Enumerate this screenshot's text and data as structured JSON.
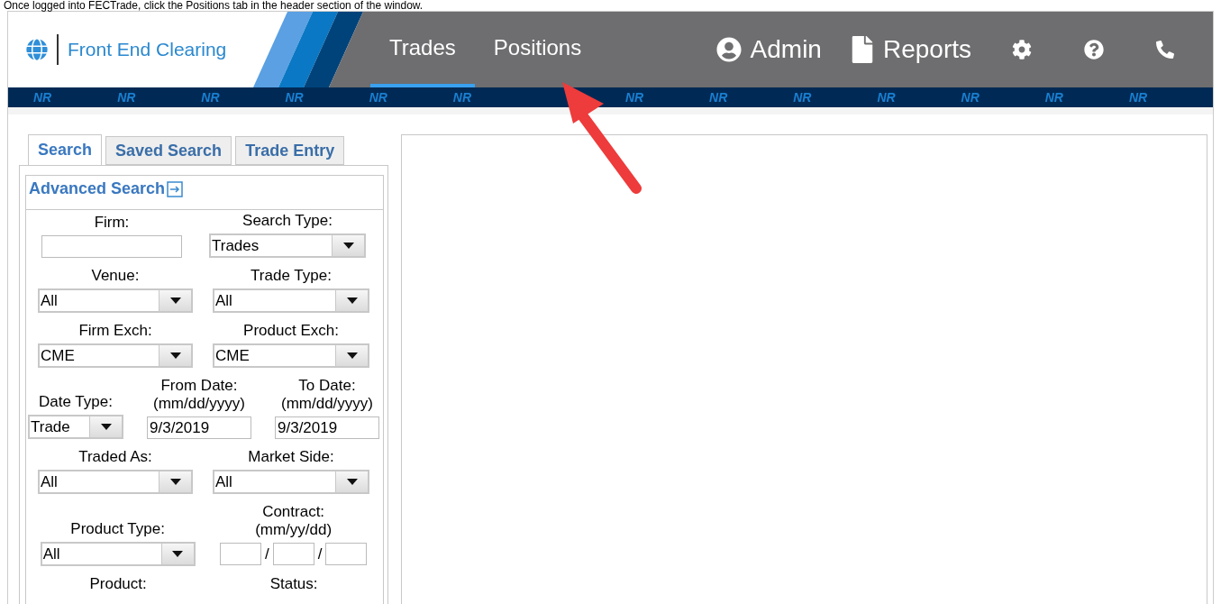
{
  "caption": "Once logged into FECTrade, click the Positions tab in the header section of the window.",
  "header": {
    "logo_text": "Front End Clearing",
    "nav": [
      {
        "label": "Trades",
        "selected": true
      },
      {
        "label": "Positions",
        "selected": false
      }
    ],
    "actions": [
      {
        "kind": "admin",
        "label": "Admin"
      },
      {
        "kind": "reports",
        "label": "Reports"
      },
      {
        "kind": "settings"
      },
      {
        "kind": "help"
      },
      {
        "kind": "phone"
      }
    ]
  },
  "ticker": [
    "NR",
    "NR",
    "NR",
    "NR",
    "NR",
    "NR",
    "NR",
    "NR",
    "NR",
    "NR",
    "NR",
    "NR",
    "NR"
  ],
  "search_panel": {
    "tabs": [
      {
        "label": "Search",
        "selected": true
      },
      {
        "label": "Saved Search",
        "selected": false
      },
      {
        "label": "Trade Entry",
        "selected": false
      }
    ],
    "advanced_search": "Advanced Search",
    "rows": [
      [
        {
          "label": "Firm:",
          "kind": "text"
        },
        {
          "label": "Search Type:",
          "kind": "select",
          "value": "Trades"
        }
      ],
      [
        {
          "label": "Venue:",
          "kind": "select",
          "value": "All"
        },
        {
          "label": "Trade Type:",
          "kind": "select",
          "value": "All"
        }
      ],
      [
        {
          "label": "Firm Exch:",
          "kind": "select",
          "value": "CME"
        },
        {
          "label": "Product Exch:",
          "kind": "select",
          "value": "CME"
        }
      ],
      [
        {
          "label": "Date Type:",
          "kind": "select",
          "value": "Trade"
        },
        {
          "label": "From Date:",
          "hint": "(mm/dd/yyyy)",
          "kind": "text",
          "value": "9/3/2019"
        },
        {
          "label": "To Date:",
          "hint": "(mm/dd/yyyy)",
          "kind": "text",
          "value": "9/3/2019"
        }
      ],
      [
        {
          "label": "Traded As:",
          "kind": "select",
          "value": "All"
        },
        {
          "label": "Market Side:",
          "kind": "select",
          "value": "All"
        }
      ],
      [
        {
          "label": "Product Type:",
          "kind": "select",
          "value": "All"
        },
        {
          "label": "Contract:",
          "hint": "(mm/yy/dd)",
          "kind": "contract",
          "separators": [
            "/",
            "/"
          ]
        }
      ],
      [
        {
          "label": "Product:",
          "kind": "label"
        },
        {
          "label": "Status:",
          "kind": "label"
        }
      ]
    ]
  }
}
